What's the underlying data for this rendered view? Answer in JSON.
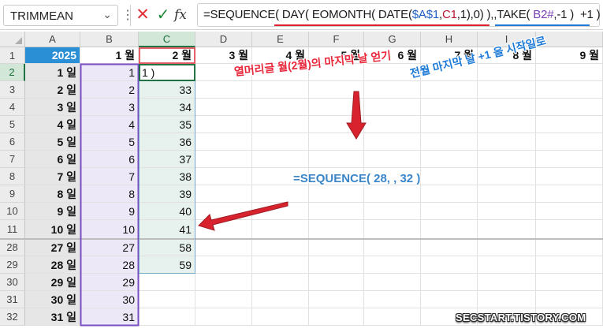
{
  "name_box": {
    "value": "TRIMMEAN",
    "dropdown_icon": "chevron-down-icon"
  },
  "formula_bar": {
    "cancel_icon": "✕",
    "enter_icon": "✓",
    "fx_label": "fx",
    "formula_parts": [
      {
        "text": "=SEQUENCE( ",
        "color": "#1a1a1a"
      },
      {
        "text": "DAY(",
        "color": "#1a1a1a"
      },
      {
        "text": " EOMONTH( DATE(",
        "color": "#1a1a1a"
      },
      {
        "text": "$A$1",
        "color": "#1f5fc4"
      },
      {
        "text": ",",
        "color": "#1a1a1a"
      },
      {
        "text": "C1",
        "color": "#b5172f"
      },
      {
        "text": ",1),0) ),,",
        "color": "#1a1a1a"
      },
      {
        "text": "TAKE( ",
        "color": "#1a1a1a"
      },
      {
        "text": "B2#",
        "color": "#7a3fb3"
      },
      {
        "text": ",-1 )  +1 )",
        "color": "#1a1a1a"
      }
    ]
  },
  "columns": [
    "A",
    "B",
    "C",
    "D",
    "E",
    "F",
    "G",
    "H",
    "I"
  ],
  "rows": [
    {
      "row": "1",
      "a": "2025",
      "b": "1 월",
      "c": "2 월",
      "d": "3 월",
      "e": "4 월",
      "f": "5 월",
      "g": "6 월",
      "h": "7 월",
      "i": "8 월",
      "j": "9 월"
    },
    {
      "row": "2",
      "a": "1 일",
      "b": "1",
      "c": "1 )"
    },
    {
      "row": "3",
      "a": "2 일",
      "b": "2",
      "c": "33"
    },
    {
      "row": "4",
      "a": "3 일",
      "b": "3",
      "c": "34"
    },
    {
      "row": "5",
      "a": "4 일",
      "b": "4",
      "c": "35"
    },
    {
      "row": "6",
      "a": "5 일",
      "b": "5",
      "c": "36"
    },
    {
      "row": "7",
      "a": "6 일",
      "b": "6",
      "c": "37"
    },
    {
      "row": "8",
      "a": "7 일",
      "b": "7",
      "c": "38"
    },
    {
      "row": "9",
      "a": "8 일",
      "b": "8",
      "c": "39"
    },
    {
      "row": "10",
      "a": "9 일",
      "b": "9",
      "c": "40"
    },
    {
      "row": "11",
      "a": "10 일",
      "b": "10",
      "c": "41"
    },
    {
      "row": "28",
      "a": "27 일",
      "b": "27",
      "c": "58"
    },
    {
      "row": "29",
      "a": "28 일",
      "b": "28",
      "c": "59"
    },
    {
      "row": "30",
      "a": "29 일",
      "b": "29",
      "c": ""
    },
    {
      "row": "31",
      "a": "30 일",
      "b": "30",
      "c": ""
    },
    {
      "row": "32",
      "a": "31 일",
      "b": "31",
      "c": ""
    }
  ],
  "annotations": {
    "red_note": "열머리글 월(2월)의 마지막 날 얻기",
    "blue_note": "전월 마지막 날 +1 을 시작일로",
    "sequence_note": "=SEQUENCE( 28, , 32 )",
    "watermark": "SECSTART.TISTORY.COM"
  },
  "colors": {
    "year_header_bg": "#2b8fd6",
    "spill_b_fill": "#ece8f7",
    "spill_b_border": "#7a4fc4",
    "spill_c_fill": "#e7f2ef",
    "spill_c_border": "#7aa6c8",
    "sel_border": "#217346",
    "red_arrow": "#d8232e",
    "ref_red_border": "#e0313a"
  }
}
